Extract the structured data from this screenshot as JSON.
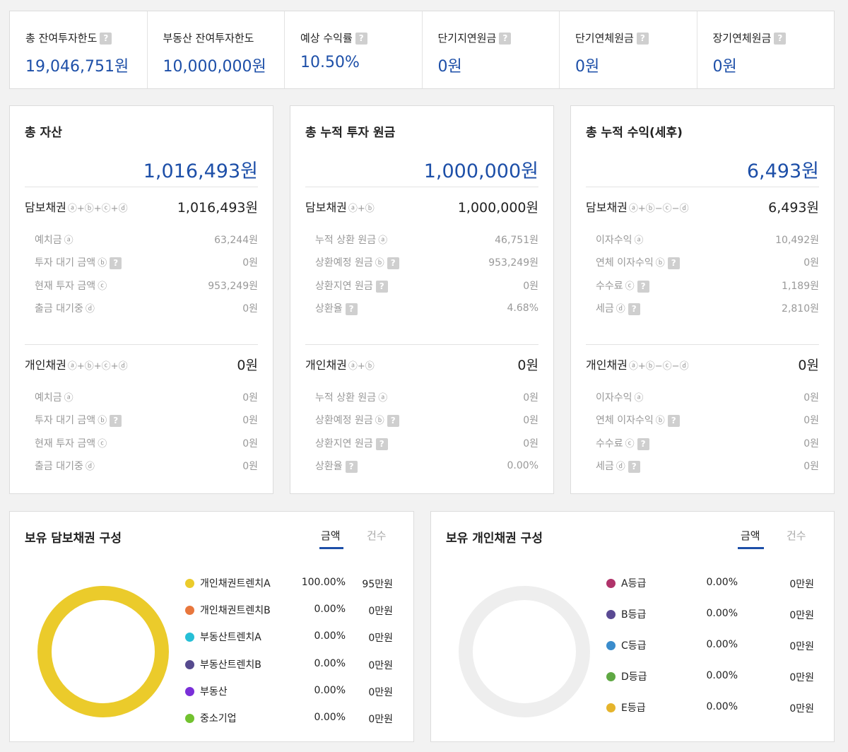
{
  "summary": [
    {
      "label": "총 잔여투자한도",
      "value": "19,046,751원"
    },
    {
      "label": "부동산 잔여투자한도",
      "value": "10,000,000원"
    },
    {
      "label": "예상 수익률",
      "value": "10.50%"
    },
    {
      "label": "단기지연원금",
      "value": "0원"
    },
    {
      "label": "단기연체원금",
      "value": "0원"
    },
    {
      "label": "장기연체원금",
      "value": "0원"
    }
  ],
  "help_glyph": "?",
  "cards": [
    {
      "title": "총 자산",
      "total": "1,016,493원",
      "sections": [
        {
          "label": "담보채권",
          "formula": "ⓐ+ⓑ+ⓒ+ⓓ",
          "value": "1,016,493원",
          "rows": [
            {
              "label": "예치금",
              "mark": "ⓐ",
              "help": false,
              "value": "63,244원"
            },
            {
              "label": "투자 대기 금액",
              "mark": "ⓑ",
              "help": true,
              "value": "0원"
            },
            {
              "label": "현재 투자 금액",
              "mark": "ⓒ",
              "help": false,
              "value": "953,249원"
            },
            {
              "label": "출금 대기중",
              "mark": "ⓓ",
              "help": false,
              "value": "0원"
            }
          ]
        },
        {
          "label": "개인채권",
          "formula": "ⓐ+ⓑ+ⓒ+ⓓ",
          "value": "0원",
          "rows": [
            {
              "label": "예치금",
              "mark": "ⓐ",
              "help": false,
              "value": "0원"
            },
            {
              "label": "투자 대기 금액",
              "mark": "ⓑ",
              "help": true,
              "value": "0원"
            },
            {
              "label": "현재 투자 금액",
              "mark": "ⓒ",
              "help": false,
              "value": "0원"
            },
            {
              "label": "출금 대기중",
              "mark": "ⓓ",
              "help": false,
              "value": "0원"
            }
          ]
        }
      ]
    },
    {
      "title": "총 누적 투자 원금",
      "total": "1,000,000원",
      "sections": [
        {
          "label": "담보채권",
          "formula": "ⓐ+ⓑ",
          "value": "1,000,000원",
          "rows": [
            {
              "label": "누적 상환 원금",
              "mark": "ⓐ",
              "help": false,
              "value": "46,751원"
            },
            {
              "label": "상환예정 원금",
              "mark": "ⓑ",
              "help": true,
              "value": "953,249원"
            },
            {
              "label": "상환지연 원금",
              "mark": "",
              "help": true,
              "value": "0원"
            },
            {
              "label": "상환율",
              "mark": "",
              "help": true,
              "value": "4.68%"
            }
          ]
        },
        {
          "label": "개인채권",
          "formula": "ⓐ+ⓑ",
          "value": "0원",
          "rows": [
            {
              "label": "누적 상환 원금",
              "mark": "ⓐ",
              "help": false,
              "value": "0원"
            },
            {
              "label": "상환예정 원금",
              "mark": "ⓑ",
              "help": true,
              "value": "0원"
            },
            {
              "label": "상환지연 원금",
              "mark": "",
              "help": true,
              "value": "0원"
            },
            {
              "label": "상환율",
              "mark": "",
              "help": true,
              "value": "0.00%"
            }
          ]
        }
      ]
    },
    {
      "title": "총 누적 수익(세후)",
      "total": "6,493원",
      "sections": [
        {
          "label": "담보채권",
          "formula": "ⓐ+ⓑ−ⓒ−ⓓ",
          "value": "6,493원",
          "rows": [
            {
              "label": "이자수익",
              "mark": "ⓐ",
              "help": false,
              "value": "10,492원"
            },
            {
              "label": "연체 이자수익",
              "mark": "ⓑ",
              "help": true,
              "value": "0원"
            },
            {
              "label": "수수료",
              "mark": "ⓒ",
              "help": true,
              "value": "1,189원"
            },
            {
              "label": "세금",
              "mark": "ⓓ",
              "help": true,
              "value": "2,810원"
            }
          ]
        },
        {
          "label": "개인채권",
          "formula": "ⓐ+ⓑ−ⓒ−ⓓ",
          "value": "0원",
          "rows": [
            {
              "label": "이자수익",
              "mark": "ⓐ",
              "help": false,
              "value": "0원"
            },
            {
              "label": "연체 이자수익",
              "mark": "ⓑ",
              "help": true,
              "value": "0원"
            },
            {
              "label": "수수료",
              "mark": "ⓒ",
              "help": true,
              "value": "0원"
            },
            {
              "label": "세금",
              "mark": "ⓓ",
              "help": true,
              "value": "0원"
            }
          ]
        }
      ]
    }
  ],
  "composition": [
    {
      "title": "보유 담보채권 구성",
      "tabs": [
        "금액",
        "건수"
      ],
      "active_tab": 0,
      "ring_color": "#ebcb2b",
      "items": [
        {
          "name": "개인채권트렌치A",
          "color": "#ebcb2b",
          "pct": "100.00%",
          "amount": "95만원"
        },
        {
          "name": "개인채권트렌치B",
          "color": "#e8773d",
          "pct": "0.00%",
          "amount": "0만원"
        },
        {
          "name": "부동산트렌치A",
          "color": "#26bfd6",
          "pct": "0.00%",
          "amount": "0만원"
        },
        {
          "name": "부동산트렌치B",
          "color": "#564a8e",
          "pct": "0.00%",
          "amount": "0만원"
        },
        {
          "name": "부동산",
          "color": "#7a2fd8",
          "pct": "0.00%",
          "amount": "0만원"
        },
        {
          "name": "중소기업",
          "color": "#72c22f",
          "pct": "0.00%",
          "amount": "0만원"
        }
      ]
    },
    {
      "title": "보유 개인채권 구성",
      "tabs": [
        "금액",
        "건수"
      ],
      "active_tab": 0,
      "ring_color": "#eeeeee",
      "items": [
        {
          "name": "A등급",
          "color": "#b0336a",
          "pct": "0.00%",
          "amount": "0만원"
        },
        {
          "name": "B등급",
          "color": "#5a4a93",
          "pct": "0.00%",
          "amount": "0만원"
        },
        {
          "name": "C등급",
          "color": "#3a8ccc",
          "pct": "0.00%",
          "amount": "0만원"
        },
        {
          "name": "D등급",
          "color": "#5fa843",
          "pct": "0.00%",
          "amount": "0만원"
        },
        {
          "name": "E등급",
          "color": "#e5b42c",
          "pct": "0.00%",
          "amount": "0만원"
        }
      ]
    }
  ]
}
